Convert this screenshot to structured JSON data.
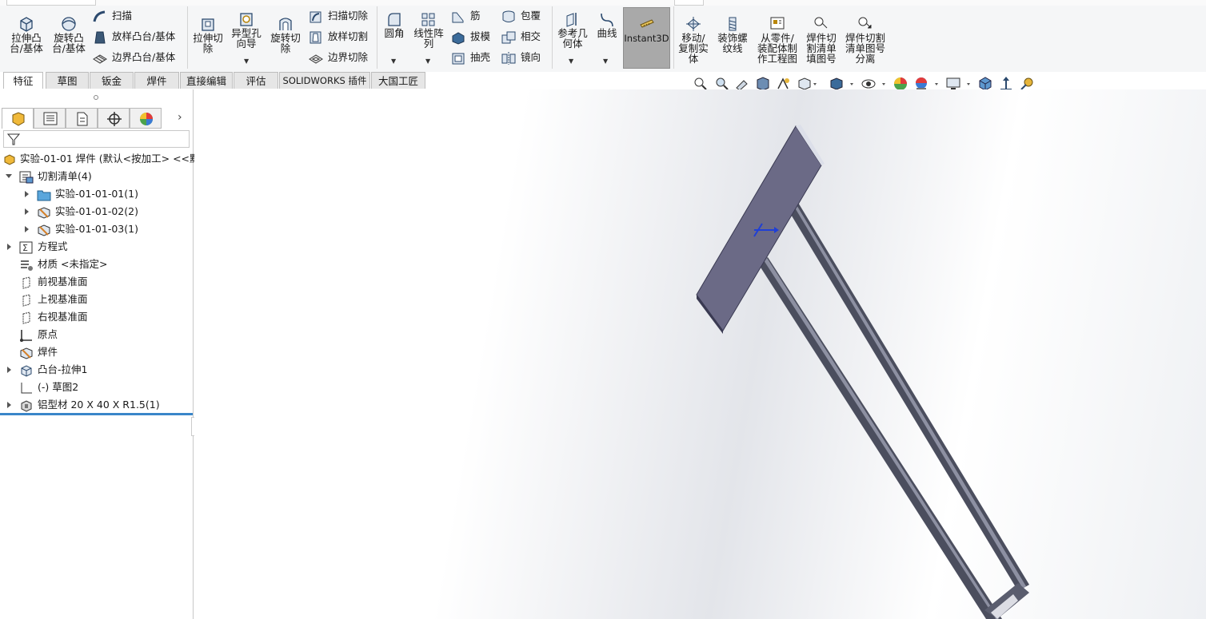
{
  "ribbon": {
    "buttons": {
      "extrude_boss": "拉伸凸\n台/基体",
      "revolve_boss": "旋转凸\n台/基体",
      "sweep": "扫描",
      "loft_boss": "放样凸台/基体",
      "boundary_boss": "边界凸台/基体",
      "extrude_cut": "拉伸切\n除",
      "hole_wizard": "异型孔\n向导",
      "revolve_cut": "旋转切\n除",
      "sweep_cut": "扫描切除",
      "loft_cut": "放样切割",
      "boundary_cut": "边界切除",
      "fillet": "圆角",
      "linear_pattern": "线性阵\n列",
      "rib": "筋",
      "draft": "拔模",
      "shell": "抽壳",
      "wrap": "包覆",
      "intersect": "相交",
      "mirror": "镜向",
      "ref_geometry": "参考几\n何体",
      "curves": "曲线",
      "instant3d": "Instant3D",
      "move_copy": "移动/\n复制实\n体",
      "cosmetic_thread": "装饰螺\n纹线",
      "make_drawing": "从零件/\n装配体制\n作工程图",
      "weld_cutlist_balloon": "焊件切\n割清单\n填图号",
      "weld_cutlist_detach": "焊件切割\n清单图号\n分离"
    }
  },
  "tabs": [
    "特征",
    "草图",
    "钣金",
    "焊件",
    "直接编辑",
    "评估",
    "SOLIDWORKS 插件",
    "大国工匠"
  ],
  "tree": {
    "root": "实验-01-01 焊件  (默认<按加工> <<默认",
    "cutlist": "切割清单(4)",
    "cut_items": [
      "实验-01-01-01(1)",
      "实验-01-01-02(2)",
      "实验-01-01-03(1)"
    ],
    "equations": "方程式",
    "material": "材质 <未指定>",
    "front_plane": "前视基准面",
    "top_plane": "上视基准面",
    "right_plane": "右视基准面",
    "origin": "原点",
    "weldments": "焊件",
    "boss_extrude": "凸台-拉伸1",
    "sketch": "(-) 草图2",
    "structural_member": "铝型材 20 X 40 X R1.5(1)"
  },
  "colors": {
    "plate_face": "#6b6a86",
    "plate_edge": "#3a3a52",
    "rail": "#4b4e5e",
    "rollback": "#3a86c9",
    "instant3d_bg": "#a9a9a9"
  }
}
